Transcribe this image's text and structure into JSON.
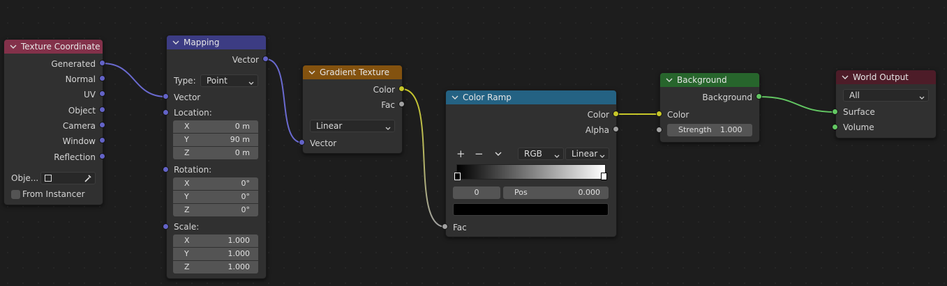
{
  "colors": {
    "input_header": "#83314a",
    "vector_header": "#3c3c83",
    "texture_header": "#83520f",
    "converter_header": "#246283",
    "shader_header": "#27652c",
    "output_header": "#4d1c28",
    "socket_vector": "#6363c7",
    "socket_color": "#c7c729",
    "socket_float": "#a1a1a1",
    "socket_shader": "#63c763"
  },
  "nodes": {
    "texture_coordinate": {
      "title": "Texture Coordinate",
      "outputs": [
        "Generated",
        "Normal",
        "UV",
        "Object",
        "Camera",
        "Window",
        "Reflection"
      ],
      "object_label": "Obje...",
      "from_instancer": "From Instancer"
    },
    "mapping": {
      "title": "Mapping",
      "output_vector": "Vector",
      "type_label": "Type:",
      "type_value": "Point",
      "input_vector": "Vector",
      "location_label": "Location:",
      "location": [
        [
          "X",
          "0 m"
        ],
        [
          "Y",
          "90 m"
        ],
        [
          "Z",
          "0 m"
        ]
      ],
      "rotation_label": "Rotation:",
      "rotation": [
        [
          "X",
          "0°"
        ],
        [
          "Y",
          "0°"
        ],
        [
          "Z",
          "0°"
        ]
      ],
      "scale_label": "Scale:",
      "scale": [
        [
          "X",
          "1.000"
        ],
        [
          "Y",
          "1.000"
        ],
        [
          "Z",
          "1.000"
        ]
      ]
    },
    "gradient_texture": {
      "title": "Gradient Texture",
      "out_color": "Color",
      "out_fac": "Fac",
      "type_value": "Linear",
      "in_vector": "Vector"
    },
    "color_ramp": {
      "title": "Color Ramp",
      "out_color": "Color",
      "out_alpha": "Alpha",
      "add": "+",
      "remove": "−",
      "color_mode": "RGB",
      "interpolation": "Linear",
      "stop_index": "0",
      "pos_label": "Pos",
      "pos_value": "0.000",
      "in_fac": "Fac"
    },
    "background": {
      "title": "Background",
      "out_background": "Background",
      "in_color": "Color",
      "strength_label": "Strength",
      "strength_value": "1.000"
    },
    "world_output": {
      "title": "World Output",
      "target": "All",
      "in_surface": "Surface",
      "in_volume": "Volume"
    }
  }
}
